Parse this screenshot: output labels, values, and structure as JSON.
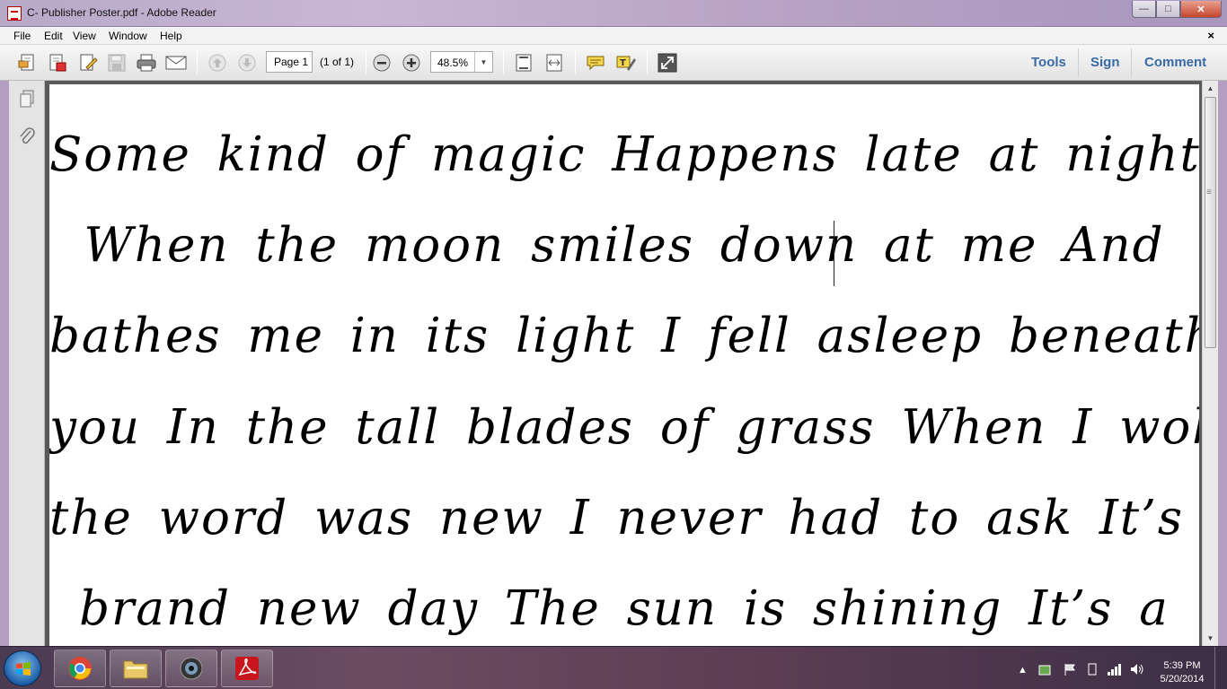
{
  "window": {
    "title": "C- Publisher Poster.pdf - Adobe Reader",
    "minimize_glyph": "—",
    "maximize_glyph": "□",
    "close_glyph": "✕"
  },
  "menu": {
    "items": [
      "File",
      "Edit",
      "View",
      "Window",
      "Help"
    ],
    "close_doc_glyph": "×"
  },
  "toolbar": {
    "page_field": "Page 1",
    "page_count": "(1 of 1)",
    "zoom": "48.5%",
    "zoom_arrow": "▼",
    "pane_buttons": [
      "Tools",
      "Sign",
      "Comment"
    ]
  },
  "document": {
    "lines": [
      "Some kind of magic  Happens late at night",
      "When the moon smiles down at me  And",
      "bathes me in its light  I fell asleep beneath",
      "you  In the tall blades of grass  When I woke",
      "the word was new  I never had to ask  It’s a",
      "brand new day  The sun is shining  It’s a"
    ]
  },
  "scrollbar": {
    "up_glyph": "▲",
    "down_glyph": "▼",
    "grip_glyph": "≡"
  },
  "taskbar": {
    "time": "5:39 PM",
    "date": "5/20/2014"
  },
  "colors": {
    "pane_link": "#3a6aa5",
    "page_bg": "#ffffff",
    "doc_bg": "#5a5a5a"
  }
}
